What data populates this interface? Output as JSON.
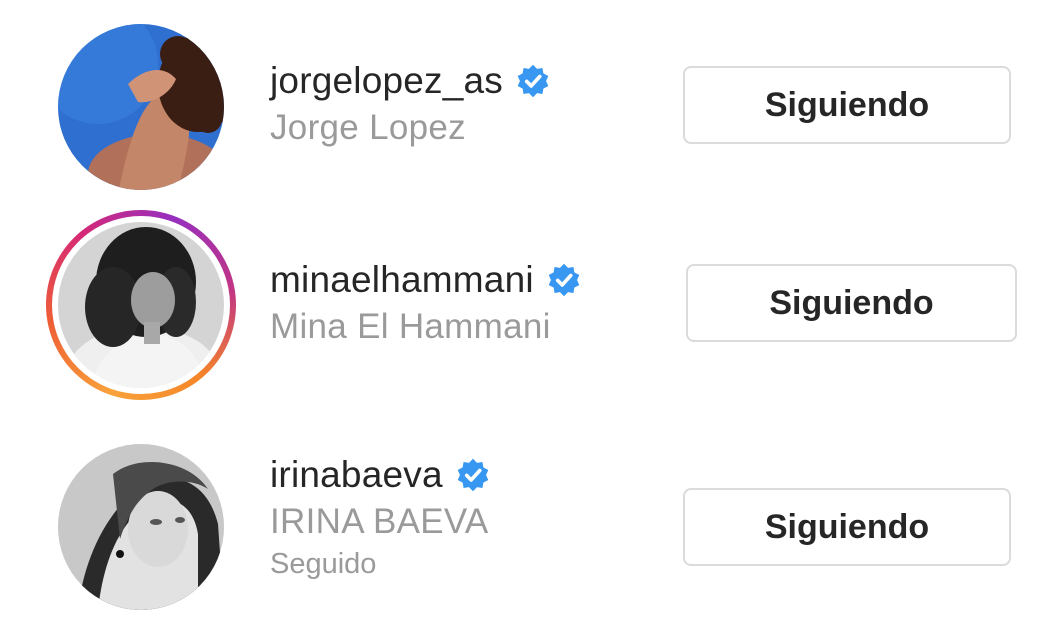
{
  "accounts": [
    {
      "username": "jorgelopez_as",
      "full_name": "Jorge Lopez",
      "subtext": "",
      "verified": true,
      "has_story": false,
      "button_label": "Siguiendo"
    },
    {
      "username": "minaelhammani",
      "full_name": "Mina El Hammani",
      "subtext": "",
      "verified": true,
      "has_story": true,
      "button_label": "Siguiendo"
    },
    {
      "username": "irinabaeva",
      "full_name": "IRINA BAEVA",
      "subtext": "Seguido",
      "verified": true,
      "has_story": false,
      "button_label": "Siguiendo"
    }
  ],
  "colors": {
    "verified_badge": "#3897f0",
    "username_text": "#262626",
    "secondary_text": "#9a9a9a",
    "button_border": "#dbdbdb"
  }
}
